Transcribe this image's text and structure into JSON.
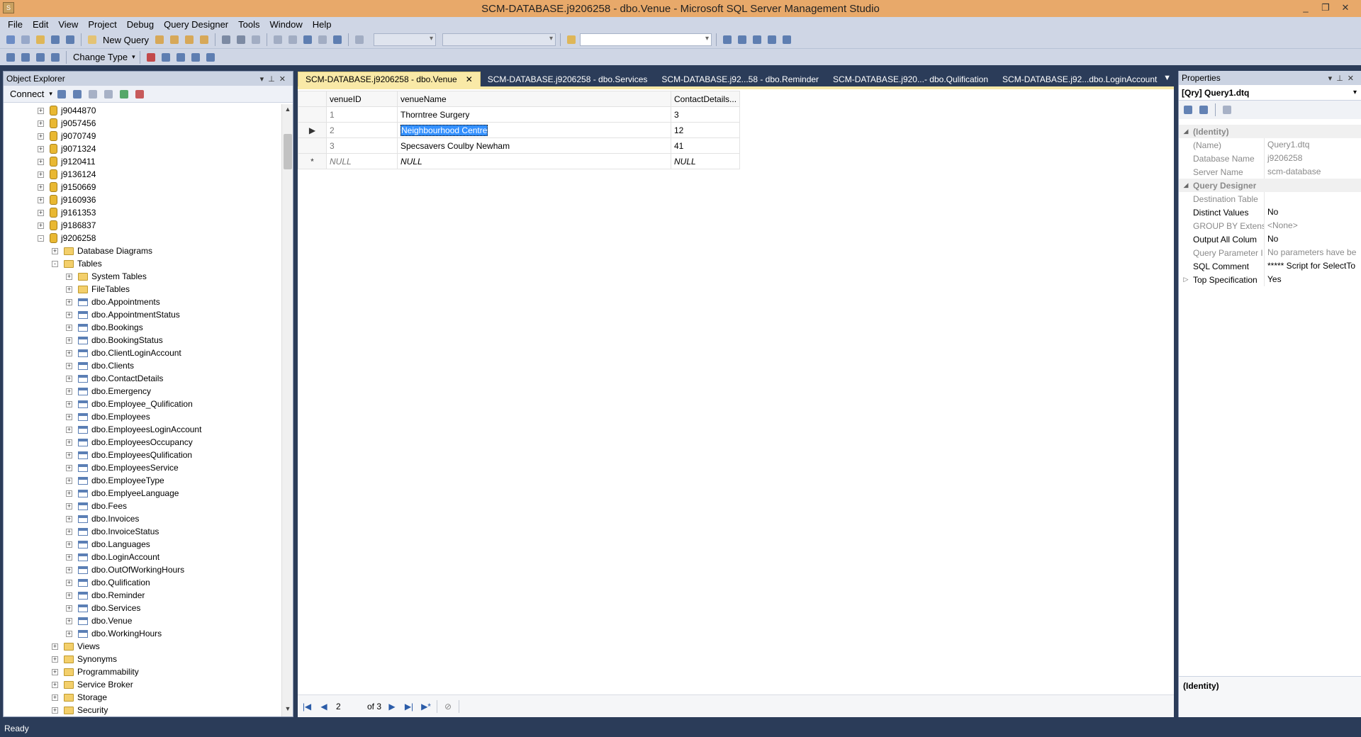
{
  "window": {
    "title": "SCM-DATABASE.j9206258 - dbo.Venue - Microsoft SQL Server Management Studio",
    "controls": [
      "_",
      "❐",
      "✕"
    ]
  },
  "menu": [
    "File",
    "Edit",
    "View",
    "Project",
    "Debug",
    "Query Designer",
    "Tools",
    "Window",
    "Help"
  ],
  "toolbar": {
    "new_query_label": "New Query",
    "change_type_label": "Change Type"
  },
  "object_explorer": {
    "title": "Object Explorer",
    "connect_label": "Connect",
    "tree": [
      {
        "label": "j9044870",
        "level": 0,
        "icon": "db",
        "exp": "+"
      },
      {
        "label": "j9057456",
        "level": 0,
        "icon": "db",
        "exp": "+"
      },
      {
        "label": "j9070749",
        "level": 0,
        "icon": "db",
        "exp": "+"
      },
      {
        "label": "j9071324",
        "level": 0,
        "icon": "db",
        "exp": "+"
      },
      {
        "label": "j9120411",
        "level": 0,
        "icon": "db",
        "exp": "+"
      },
      {
        "label": "j9136124",
        "level": 0,
        "icon": "db",
        "exp": "+"
      },
      {
        "label": "j9150669",
        "level": 0,
        "icon": "db",
        "exp": "+"
      },
      {
        "label": "j9160936",
        "level": 0,
        "icon": "db",
        "exp": "+"
      },
      {
        "label": "j9161353",
        "level": 0,
        "icon": "db",
        "exp": "+"
      },
      {
        "label": "j9186837",
        "level": 0,
        "icon": "db",
        "exp": "+"
      },
      {
        "label": "j9206258",
        "level": 0,
        "icon": "db",
        "exp": "-"
      },
      {
        "label": "Database Diagrams",
        "level": 1,
        "icon": "folder",
        "exp": "+"
      },
      {
        "label": "Tables",
        "level": 1,
        "icon": "folder",
        "exp": "-"
      },
      {
        "label": "System Tables",
        "level": 2,
        "icon": "folder",
        "exp": "+"
      },
      {
        "label": "FileTables",
        "level": 2,
        "icon": "folder",
        "exp": "+"
      },
      {
        "label": "dbo.Appointments",
        "level": 2,
        "icon": "table",
        "exp": "+"
      },
      {
        "label": "dbo.AppointmentStatus",
        "level": 2,
        "icon": "table",
        "exp": "+"
      },
      {
        "label": "dbo.Bookings",
        "level": 2,
        "icon": "table",
        "exp": "+"
      },
      {
        "label": "dbo.BookingStatus",
        "level": 2,
        "icon": "table",
        "exp": "+"
      },
      {
        "label": "dbo.ClientLoginAccount",
        "level": 2,
        "icon": "table",
        "exp": "+"
      },
      {
        "label": "dbo.Clients",
        "level": 2,
        "icon": "table",
        "exp": "+"
      },
      {
        "label": "dbo.ContactDetails",
        "level": 2,
        "icon": "table",
        "exp": "+"
      },
      {
        "label": "dbo.Emergency",
        "level": 2,
        "icon": "table",
        "exp": "+"
      },
      {
        "label": "dbo.Employee_Qulification",
        "level": 2,
        "icon": "table",
        "exp": "+"
      },
      {
        "label": "dbo.Employees",
        "level": 2,
        "icon": "table",
        "exp": "+"
      },
      {
        "label": "dbo.EmployeesLoginAccount",
        "level": 2,
        "icon": "table",
        "exp": "+"
      },
      {
        "label": "dbo.EmployeesOccupancy",
        "level": 2,
        "icon": "table",
        "exp": "+"
      },
      {
        "label": "dbo.EmployeesQulification",
        "level": 2,
        "icon": "table",
        "exp": "+"
      },
      {
        "label": "dbo.EmployeesService",
        "level": 2,
        "icon": "table",
        "exp": "+"
      },
      {
        "label": "dbo.EmployeeType",
        "level": 2,
        "icon": "table",
        "exp": "+"
      },
      {
        "label": "dbo.EmplyeeLanguage",
        "level": 2,
        "icon": "table",
        "exp": "+"
      },
      {
        "label": "dbo.Fees",
        "level": 2,
        "icon": "table",
        "exp": "+"
      },
      {
        "label": "dbo.Invoices",
        "level": 2,
        "icon": "table",
        "exp": "+"
      },
      {
        "label": "dbo.InvoiceStatus",
        "level": 2,
        "icon": "table",
        "exp": "+"
      },
      {
        "label": "dbo.Languages",
        "level": 2,
        "icon": "table",
        "exp": "+"
      },
      {
        "label": "dbo.LoginAccount",
        "level": 2,
        "icon": "table",
        "exp": "+"
      },
      {
        "label": "dbo.OutOfWorkingHours",
        "level": 2,
        "icon": "table",
        "exp": "+"
      },
      {
        "label": "dbo.Qulification",
        "level": 2,
        "icon": "table",
        "exp": "+"
      },
      {
        "label": "dbo.Reminder",
        "level": 2,
        "icon": "table",
        "exp": "+"
      },
      {
        "label": "dbo.Services",
        "level": 2,
        "icon": "table",
        "exp": "+"
      },
      {
        "label": "dbo.Venue",
        "level": 2,
        "icon": "table",
        "exp": "+"
      },
      {
        "label": "dbo.WorkingHours",
        "level": 2,
        "icon": "table",
        "exp": "+"
      },
      {
        "label": "Views",
        "level": 1,
        "icon": "folder",
        "exp": "+"
      },
      {
        "label": "Synonyms",
        "level": 1,
        "icon": "folder",
        "exp": "+"
      },
      {
        "label": "Programmability",
        "level": 1,
        "icon": "folder",
        "exp": "+"
      },
      {
        "label": "Service Broker",
        "level": 1,
        "icon": "folder",
        "exp": "+"
      },
      {
        "label": "Storage",
        "level": 1,
        "icon": "folder",
        "exp": "+"
      },
      {
        "label": "Security",
        "level": 1,
        "icon": "folder",
        "exp": "+"
      }
    ]
  },
  "tabs": [
    {
      "label": "SCM-DATABASE.j9206258 - dbo.Venue",
      "active": true
    },
    {
      "label": "SCM-DATABASE.j9206258 - dbo.Services",
      "active": false
    },
    {
      "label": "SCM-DATABASE.j92...58 - dbo.Reminder",
      "active": false
    },
    {
      "label": "SCM-DATABASE.j920...- dbo.Qulification",
      "active": false
    },
    {
      "label": "SCM-DATABASE.j92...dbo.LoginAccount",
      "active": false
    }
  ],
  "grid": {
    "columns": [
      "venueID",
      "venueName",
      "ContactDetails..."
    ],
    "rows": [
      {
        "marker": "",
        "cells": [
          "1",
          "Thorntree Surgery",
          "3"
        ]
      },
      {
        "marker": "▶",
        "cells": [
          "2",
          "Neighbourhood Centre",
          "12"
        ]
      },
      {
        "marker": "",
        "cells": [
          "3",
          "Specsavers Coulby Newham",
          "41"
        ]
      },
      {
        "marker": "*",
        "cells": [
          "NULL",
          "NULL",
          "NULL"
        ]
      }
    ]
  },
  "navigator": {
    "current": "2",
    "of_label": "of 3"
  },
  "properties": {
    "title": "Properties",
    "object": "[Qry] Query1.dtq",
    "rows": [
      {
        "type": "cat",
        "key": "(Identity)",
        "value": ""
      },
      {
        "type": "dim",
        "key": "(Name)",
        "value": "Query1.dtq"
      },
      {
        "type": "dim",
        "key": "Database Name",
        "value": "j9206258"
      },
      {
        "type": "dim",
        "key": "Server Name",
        "value": "scm-database"
      },
      {
        "type": "cat",
        "key": "Query Designer",
        "value": ""
      },
      {
        "type": "dim",
        "key": "Destination Table",
        "value": ""
      },
      {
        "type": "norm",
        "key": "Distinct Values",
        "value": "No"
      },
      {
        "type": "dim",
        "key": "GROUP BY Extensi",
        "value": "<None>"
      },
      {
        "type": "norm",
        "key": "Output All Colum",
        "value": "No"
      },
      {
        "type": "dim",
        "key": "Query Parameter I",
        "value": "No parameters have be"
      },
      {
        "type": "norm",
        "key": "SQL Comment",
        "value": "***** Script for SelectTo"
      },
      {
        "type": "exp",
        "key": "Top Specification",
        "value": "Yes"
      }
    ],
    "description_title": "(Identity)"
  },
  "status": {
    "text": "Ready"
  },
  "colors": {
    "chrome": "#2b3c59",
    "titlebar": "#e8a96a",
    "active_tab": "#f9e9a7",
    "selection": "#3390ff"
  }
}
